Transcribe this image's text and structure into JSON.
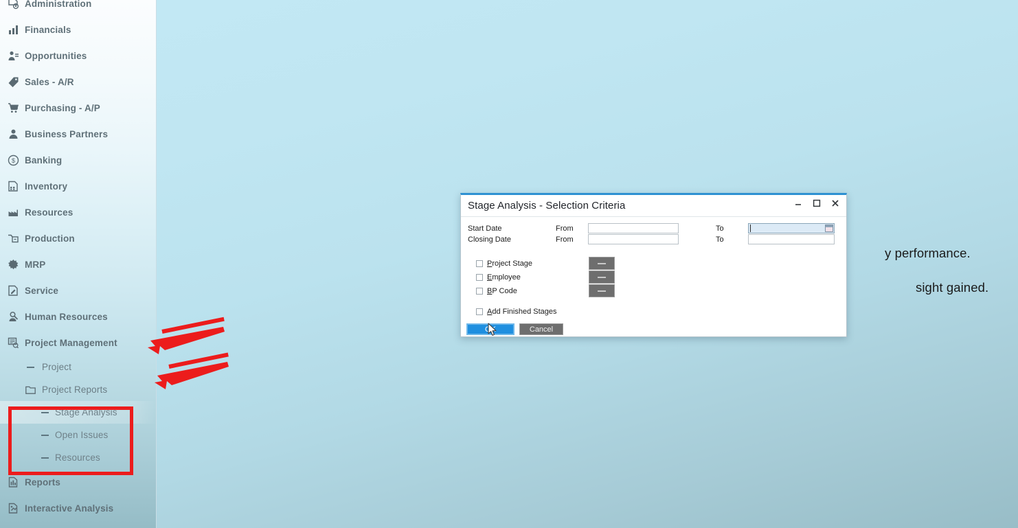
{
  "sidebar": {
    "items": [
      {
        "label": "Administration",
        "icon": "administration-icon",
        "level": 0
      },
      {
        "label": "Financials",
        "icon": "financials-chart-icon",
        "level": 0
      },
      {
        "label": "Opportunities",
        "icon": "opportunities-icon",
        "level": 0
      },
      {
        "label": "Sales - A/R",
        "icon": "sales-tag-icon",
        "level": 0
      },
      {
        "label": "Purchasing - A/P",
        "icon": "purchasing-cart-icon",
        "level": 0
      },
      {
        "label": "Business Partners",
        "icon": "business-partners-person-icon",
        "level": 0
      },
      {
        "label": "Banking",
        "icon": "banking-coin-icon",
        "level": 0
      },
      {
        "label": "Inventory",
        "icon": "inventory-box-icon",
        "level": 0
      },
      {
        "label": "Resources",
        "icon": "resources-factory-icon",
        "level": 0
      },
      {
        "label": "Production",
        "icon": "production-icon",
        "level": 0
      },
      {
        "label": "MRP",
        "icon": "mrp-gear-icon",
        "level": 0
      },
      {
        "label": "Service",
        "icon": "service-icon",
        "level": 0
      },
      {
        "label": "Human Resources",
        "icon": "human-resources-icon",
        "level": 0
      },
      {
        "label": "Project Management",
        "icon": "project-management-icon",
        "level": 0
      },
      {
        "label": "Project",
        "icon": "dash-icon",
        "level": 1
      },
      {
        "label": "Project Reports",
        "icon": "folder-icon",
        "level": 1
      },
      {
        "label": "Stage Analysis",
        "icon": "dash-icon",
        "level": 2,
        "selected": true
      },
      {
        "label": "Open Issues",
        "icon": "dash-icon",
        "level": 2
      },
      {
        "label": "Resources",
        "icon": "dash-icon",
        "level": 2
      },
      {
        "label": "Reports",
        "icon": "reports-icon",
        "level": 0
      },
      {
        "label": "Interactive Analysis",
        "icon": "interactive-analysis-icon",
        "level": 0
      }
    ]
  },
  "background_text": {
    "line1": "y performance.",
    "line2": "sight gained."
  },
  "dialog": {
    "title": "Stage Analysis - Selection Criteria",
    "window_controls": {
      "minimize": "—",
      "maximize": "☐",
      "close": "✕"
    },
    "date_rows": [
      {
        "label": "Start Date",
        "from_label": "From",
        "from_value": "",
        "to_label": "To",
        "to_value": "",
        "to_focused": true
      },
      {
        "label": "Closing Date",
        "from_label": "From",
        "from_value": "",
        "to_label": "To",
        "to_value": "",
        "to_focused": false
      }
    ],
    "checkboxes": [
      {
        "label": "Project Stage",
        "mnemonic": "P",
        "rest": "roject Stage",
        "checked": false,
        "has_selector": true
      },
      {
        "label": "Employee",
        "mnemonic": "E",
        "rest": "mployee",
        "checked": false,
        "has_selector": true
      },
      {
        "label": "BP Code",
        "mnemonic": "B",
        "rest": "P Code",
        "checked": false,
        "has_selector": true
      },
      {
        "label": "Add Finished Stages",
        "mnemonic": "A",
        "rest": "dd Finished Stages",
        "checked": false,
        "has_selector": false
      }
    ],
    "buttons": {
      "ok": "OK",
      "cancel": "Cancel"
    }
  },
  "annotations": {
    "arrow_1_target": "Project Management",
    "arrow_2_target": "Project Reports",
    "highlight_box_targets": [
      "Stage Analysis",
      "Open Issues",
      "Resources"
    ],
    "color": "#ec1c1c"
  }
}
